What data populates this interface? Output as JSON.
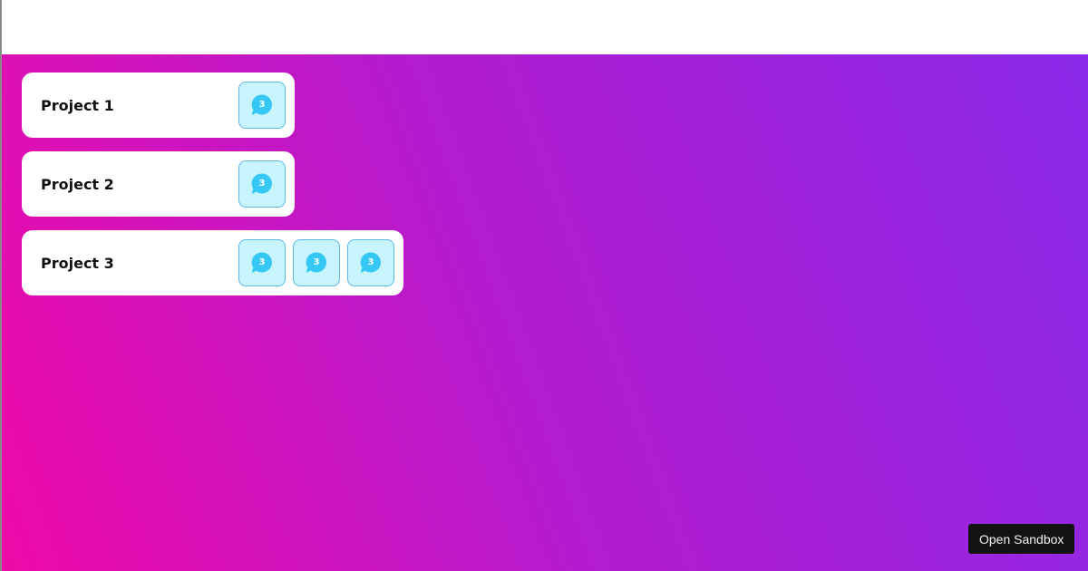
{
  "colors": {
    "gradient_start": "#ef0aa8",
    "gradient_end": "#8a2ae9",
    "badge_bg": "#c7f4fd",
    "badge_border": "#5cb7ea",
    "chat_icon": "#35c8f5"
  },
  "projects": [
    {
      "name": "Project 1",
      "badges": [
        {
          "icon": "chat-bubble-icon",
          "count": "3"
        }
      ]
    },
    {
      "name": "Project 2",
      "badges": [
        {
          "icon": "chat-bubble-icon",
          "count": "3"
        }
      ]
    },
    {
      "name": "Project 3",
      "badges": [
        {
          "icon": "chat-bubble-icon",
          "count": "3"
        },
        {
          "icon": "chat-bubble-icon",
          "count": "3"
        },
        {
          "icon": "chat-bubble-icon",
          "count": "3"
        }
      ]
    }
  ],
  "footer": {
    "sandbox_label": "Open Sandbox"
  }
}
